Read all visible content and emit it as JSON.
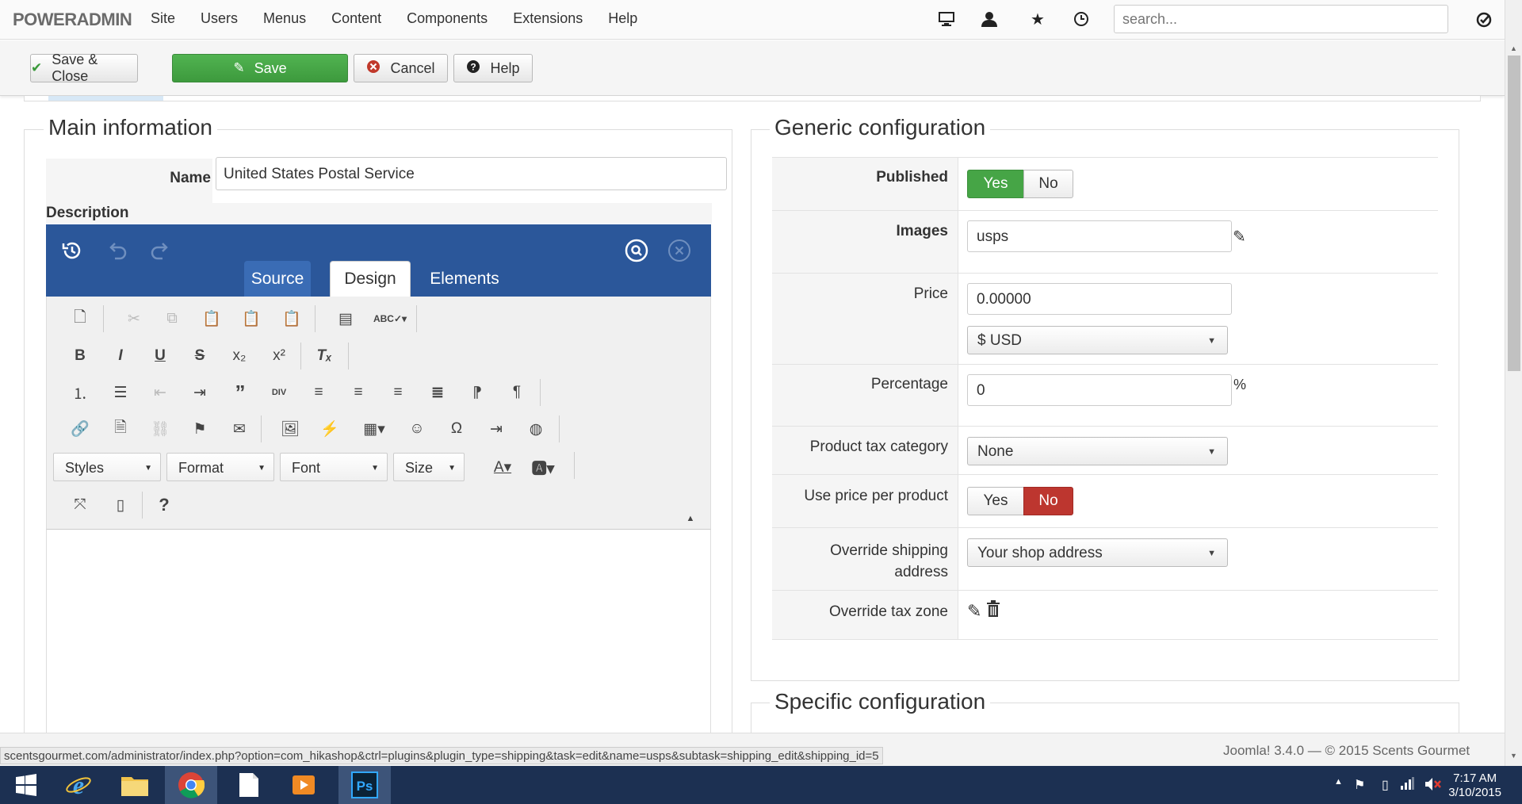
{
  "nav": {
    "brand_bold": "POWER",
    "brand_light": "ADMIN",
    "menu": [
      "Site",
      "Users",
      "Menus",
      "Content",
      "Components",
      "Extensions",
      "Help"
    ],
    "search_placeholder": "search..."
  },
  "toolbar": {
    "save_close": "Save & Close",
    "save": "Save",
    "cancel": "Cancel",
    "help": "Help"
  },
  "main": {
    "legend": "Main information",
    "name_label": "Name",
    "name_value": "United States Postal Service",
    "description_label": "Description",
    "editor": {
      "tabs": [
        "Source",
        "Design",
        "Elements"
      ],
      "combos": [
        "Styles",
        "Format",
        "Font",
        "Size"
      ]
    }
  },
  "generic": {
    "legend": "Generic configuration",
    "published_label": "Published",
    "yes": "Yes",
    "no": "No",
    "images_label": "Images",
    "images_value": "usps",
    "price_label": "Price",
    "price_value": "0.00000",
    "currency_value": "$ USD",
    "percentage_label": "Percentage",
    "percentage_value": "0",
    "percent_sign": "%",
    "tax_category_label": "Product tax category",
    "tax_category_value": "None",
    "price_per_product_label": "Use price per product",
    "override_shipping_label_1": "Override shipping",
    "override_shipping_label_2": "address",
    "override_shipping_value": "Your shop address",
    "override_tax_zone_label": "Override tax zone"
  },
  "specific": {
    "legend": "Specific configuration"
  },
  "status": {
    "url": "scentsgourmet.com/administrator/index.php?option=com_hikashop&ctrl=plugins&plugin_type=shipping&task=edit&name=usps&subtask=shipping_edit&shipping_id=5",
    "footer": "Joomla! 3.4.0  —  © 2015 Scents Gourmet"
  },
  "taskbar": {
    "time": "7:17 AM",
    "date": "3/10/2015"
  },
  "colors": {
    "editor_header": "#2b579a",
    "toggle_on": "#46a546",
    "toggle_off": "#bd362f",
    "taskbar": "#1c3052"
  }
}
